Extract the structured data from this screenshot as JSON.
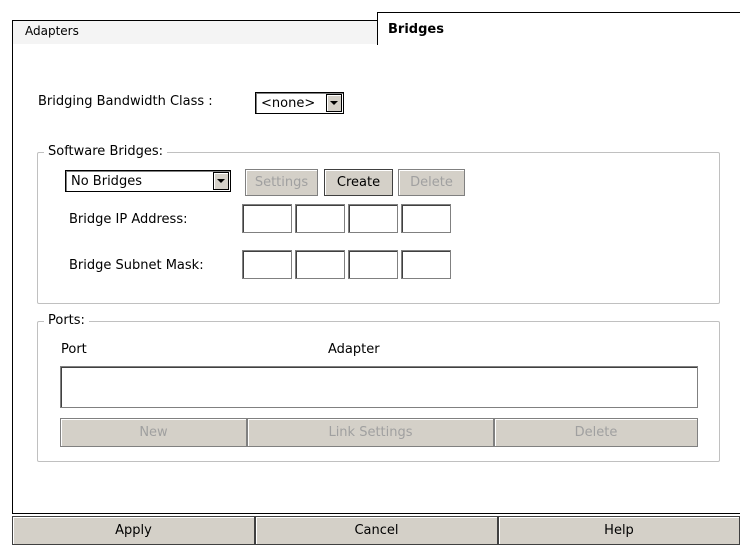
{
  "tabs": {
    "inactive_label": "Adapters",
    "active_label": "Bridges"
  },
  "bandwidth": {
    "label": "Bridging Bandwidth Class :",
    "selected": "<none>"
  },
  "software_bridges": {
    "group_label": "Software Bridges:",
    "selected_bridge": "No Bridges",
    "settings_label": "Settings",
    "create_label": "Create",
    "delete_label": "Delete",
    "ip_label": "Bridge IP Address:",
    "mask_label": "Bridge Subnet Mask:"
  },
  "ports": {
    "group_label": "Ports:",
    "columns": [
      "Port",
      "Adapter"
    ],
    "new_label": "New",
    "link_settings_label": "Link Settings",
    "delete_label": "Delete"
  },
  "footer": {
    "apply_label": "Apply",
    "cancel_label": "Cancel",
    "help_label": "Help"
  }
}
